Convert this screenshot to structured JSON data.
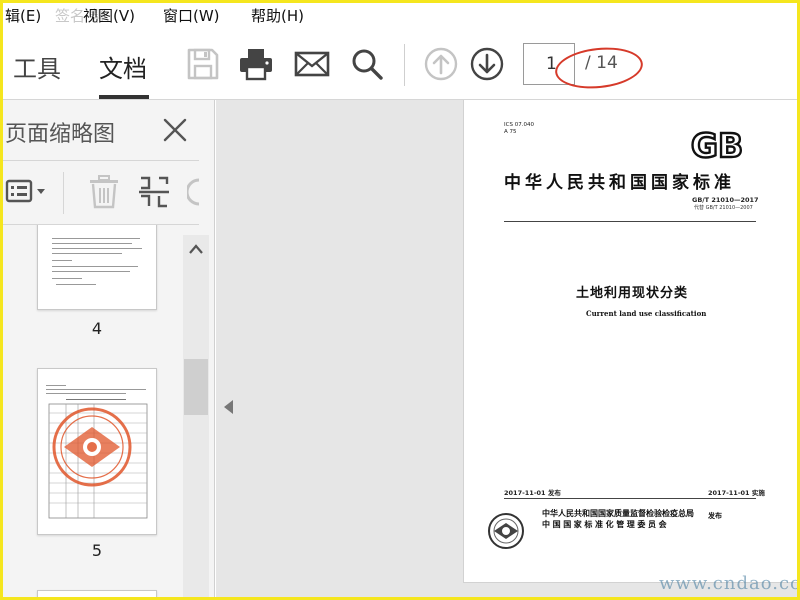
{
  "menu": {
    "partial_label": "辑(E)",
    "ghost_label": "签名 帮",
    "items": [
      {
        "label": "视图(V)"
      },
      {
        "label": "窗口(W)"
      },
      {
        "label": "帮助(H)"
      }
    ]
  },
  "toolbar": {
    "tabs": [
      {
        "label": "工具"
      },
      {
        "label": "文档"
      }
    ],
    "active_tab": "文档",
    "page_current": "1",
    "page_total": "/ 14",
    "icons": [
      "save-icon",
      "print-icon",
      "email-icon",
      "search-icon",
      "page-up-icon",
      "page-down-icon"
    ]
  },
  "thumbnail_panel": {
    "title": "页面缩略图",
    "thumbnails": [
      {
        "page_label": "4"
      },
      {
        "page_label": "5"
      }
    ]
  },
  "document": {
    "ics": "ICS 07.040",
    "class_code": "A 75",
    "logo_text": "GB",
    "standard_title": "中华人民共和国国家标准",
    "standard_code": "GB/T 21010—2017",
    "replaces": "代替 GB/T 21010—2007",
    "title_cn": "土地利用现状分类",
    "title_en": "Current land use classification",
    "publish_date": "2017-11-01 发布",
    "implement_date": "2017-11-01 实施",
    "issuer_1": "中华人民共和国国家质量监督检验检疫总局",
    "issuer_2": "中国国家标准化管理委员会",
    "issue_word": "发布"
  },
  "watermark": "www.cndao.com",
  "colors": {
    "frame": "#f5e61e",
    "annotation": "#d63a2a",
    "disabled_icon": "#c4c4c4",
    "active_icon": "#444444",
    "seal_red": "#e0562a"
  }
}
